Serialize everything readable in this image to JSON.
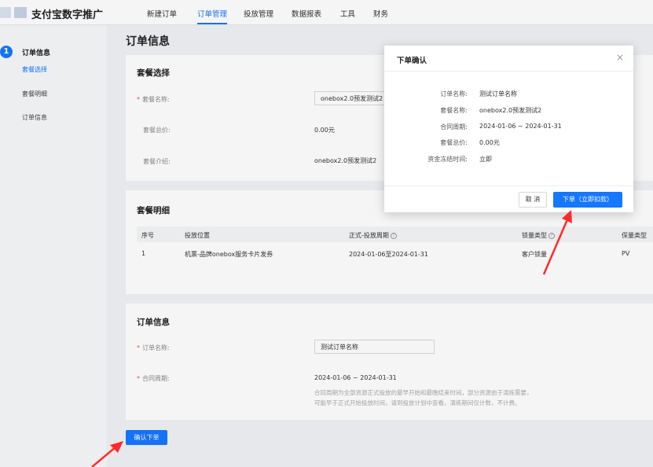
{
  "app": {
    "brand": "支付宝数字推广"
  },
  "nav": {
    "items": [
      "新建订单",
      "订单管理",
      "投放管理",
      "数据报表",
      "工具",
      "财务"
    ],
    "active_index": 1
  },
  "sidebar": {
    "step_number": "1",
    "step_title": "订单信息",
    "sub_items": [
      "套餐选择",
      "套餐明细",
      "订单信息"
    ]
  },
  "page": {
    "title": "订单信息"
  },
  "package_select": {
    "title": "套餐选择",
    "name_label": "套餐名称:",
    "name_value": "onebox2.0预发测试2",
    "total_label": "套餐总价:",
    "total_value": "0.00元",
    "intro_label": "套餐介绍:",
    "intro_value": "onebox2.0预发测试2"
  },
  "package_detail": {
    "title": "套餐明细",
    "columns": [
      "序号",
      "投放位置",
      "正式-投放周期",
      "锁量类型",
      "保量类型"
    ],
    "rows": [
      [
        "1",
        "机票-品牌onebox服务卡片发券",
        "2024-01-06至2024-01-31",
        "客户锁量",
        "PV"
      ]
    ]
  },
  "order_info": {
    "title": "订单信息",
    "name_label": "订单名称:",
    "name_value": "测试订单名称",
    "period_label": "合同周期:",
    "period_value": "2024-01-06 ~ 2024-01-31",
    "hint_line1": "合同周期为全部资源正式投放的最早开始和最晚结束时间，部分资源由于演练需要，",
    "hint_line2": "可能早于正式开始投放时间，请到投放计划中查看，演练期间仅计数，不计费。"
  },
  "confirm_button": "确认下单",
  "modal": {
    "title": "下单确认",
    "close_glyph": "×",
    "fields": [
      {
        "label": "订单名称:",
        "value": "测试订单名称"
      },
      {
        "label": "套餐名称:",
        "value": "onebox2.0预发测试2"
      },
      {
        "label": "合同周期:",
        "value": "2024-01-06 ~ 2024-01-31"
      },
      {
        "label": "套餐总价:",
        "value": "0.00元"
      },
      {
        "label": "资金冻结时间:",
        "value": "立即"
      }
    ],
    "cancel_label": "取 消",
    "ok_label": "下单（立即扣款）"
  },
  "colors": {
    "accent": "#1677ff",
    "annotation": "#ff2a2a"
  }
}
